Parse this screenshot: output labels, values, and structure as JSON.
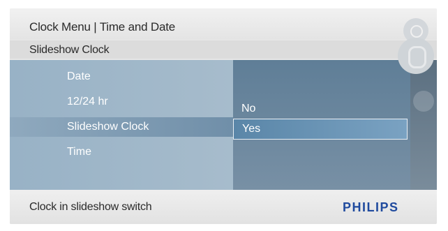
{
  "header": {
    "title": "Clock Menu | Time and Date"
  },
  "subheader": {
    "title": "Slideshow Clock"
  },
  "menu": {
    "items": [
      {
        "label": "Date"
      },
      {
        "label": "12/24 hr"
      },
      {
        "label": "Slideshow Clock",
        "selected": true
      },
      {
        "label": "Time"
      }
    ]
  },
  "options": {
    "items": [
      {
        "label": "No"
      },
      {
        "label": "Yes",
        "selected": true
      }
    ]
  },
  "side_controls": {
    "icons": [
      "power-icon",
      "navigation-pad-icon",
      "menu-button-icon"
    ]
  },
  "footer": {
    "hint": "Clock in slideshow switch",
    "brand": "PHILIPS"
  },
  "colors": {
    "panel": "#9ab0c2",
    "selection": "#6f8ea8",
    "brand": "#1f4a9e"
  }
}
